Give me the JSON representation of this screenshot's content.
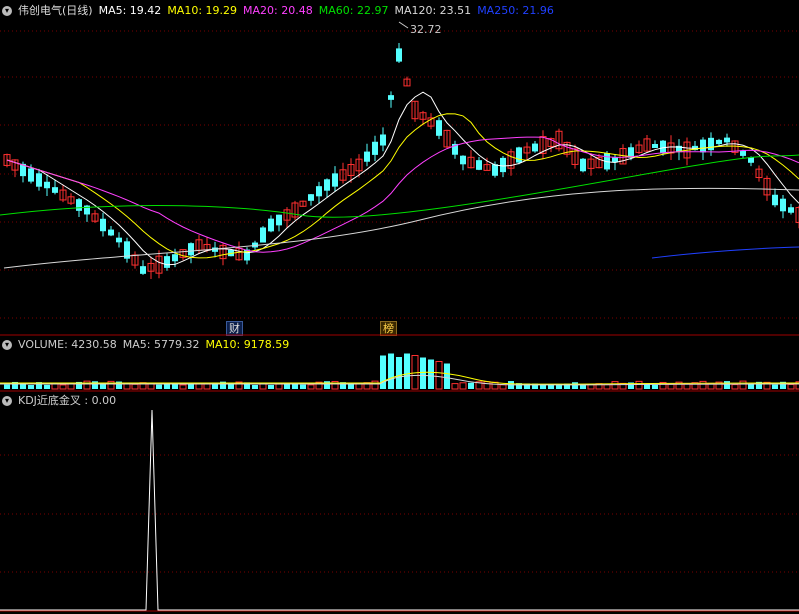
{
  "stock": {
    "title": "伟创电气(日线)"
  },
  "main_legend": [
    {
      "label": "MA5: 19.42",
      "color": "#ffffff"
    },
    {
      "label": "MA10: 19.29",
      "color": "#ffff00"
    },
    {
      "label": "MA20: 20.48",
      "color": "#ff40ff"
    },
    {
      "label": "MA60: 22.97",
      "color": "#00e000"
    },
    {
      "label": "MA120: 23.51",
      "color": "#d8d8d8"
    },
    {
      "label": "MA250: 21.96",
      "color": "#2040ff"
    }
  ],
  "volume_legend": [
    {
      "label": "VOLUME: 4230.58",
      "color": "#d8d8d8"
    },
    {
      "label": "MA5: 5779.32",
      "color": "#d8d8d8"
    },
    {
      "label": "MA10: 9178.59",
      "color": "#ffff00"
    }
  ],
  "kdj_legend": [
    {
      "label": "KDJ近底金叉 : 0.00",
      "color": "#d8d8d8"
    }
  ],
  "markers": {
    "cai": "财",
    "bang": "榜"
  },
  "peak_label": "32.72",
  "colors": {
    "up": "#ff3030",
    "down": "#54ffff",
    "grid": "#7a0000"
  }
}
